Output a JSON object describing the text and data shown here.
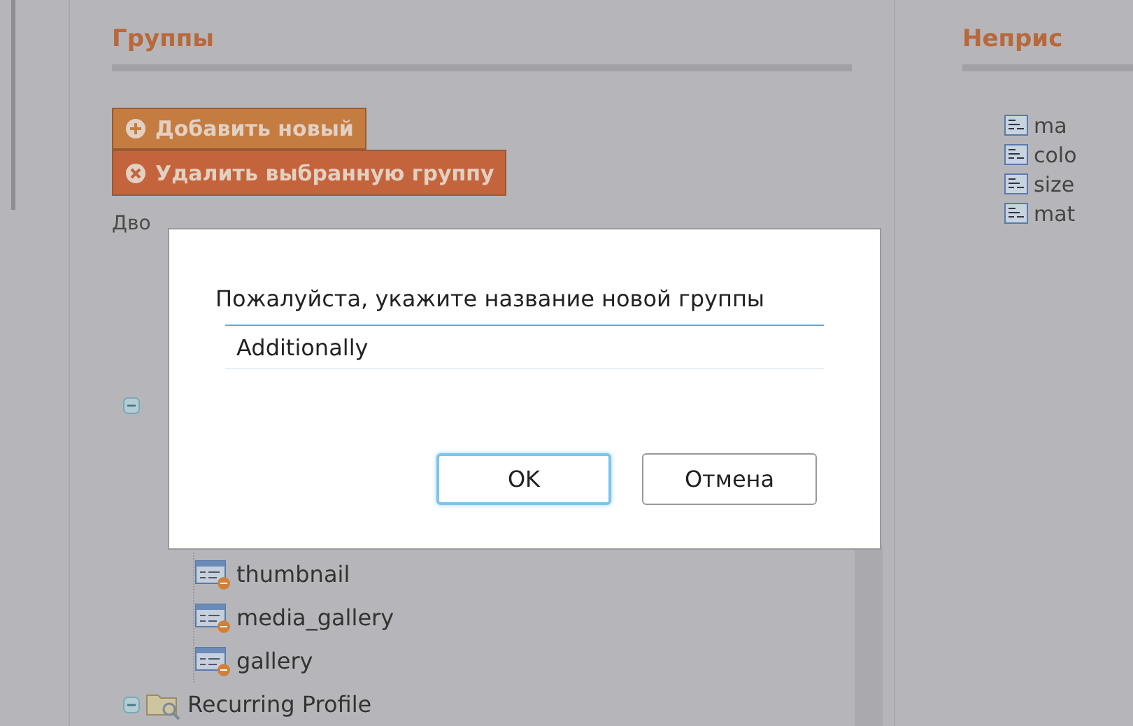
{
  "groups_panel": {
    "title": "Группы",
    "buttons": [
      {
        "kind": "add",
        "label": "Добавить новый"
      },
      {
        "kind": "delete",
        "label": "Удалить выбранную группу"
      }
    ],
    "hint": "Дво",
    "tree": [
      {
        "expanded": true,
        "children": [
          {
            "label": "thumbnail"
          },
          {
            "label": "media_gallery"
          },
          {
            "label": "gallery"
          }
        ]
      },
      {
        "label": "Recurring Profile",
        "expanded": true
      }
    ]
  },
  "unassigned_panel": {
    "title": "Неприс",
    "items": [
      "ma",
      "colo",
      "size",
      "mat"
    ]
  },
  "dialog": {
    "message": "Пожалуйста, укажите название новой группы",
    "value": "Additionally",
    "buttons": [
      {
        "label": "OK",
        "selected": true
      },
      {
        "label": "Отмена",
        "selected": false
      }
    ]
  }
}
